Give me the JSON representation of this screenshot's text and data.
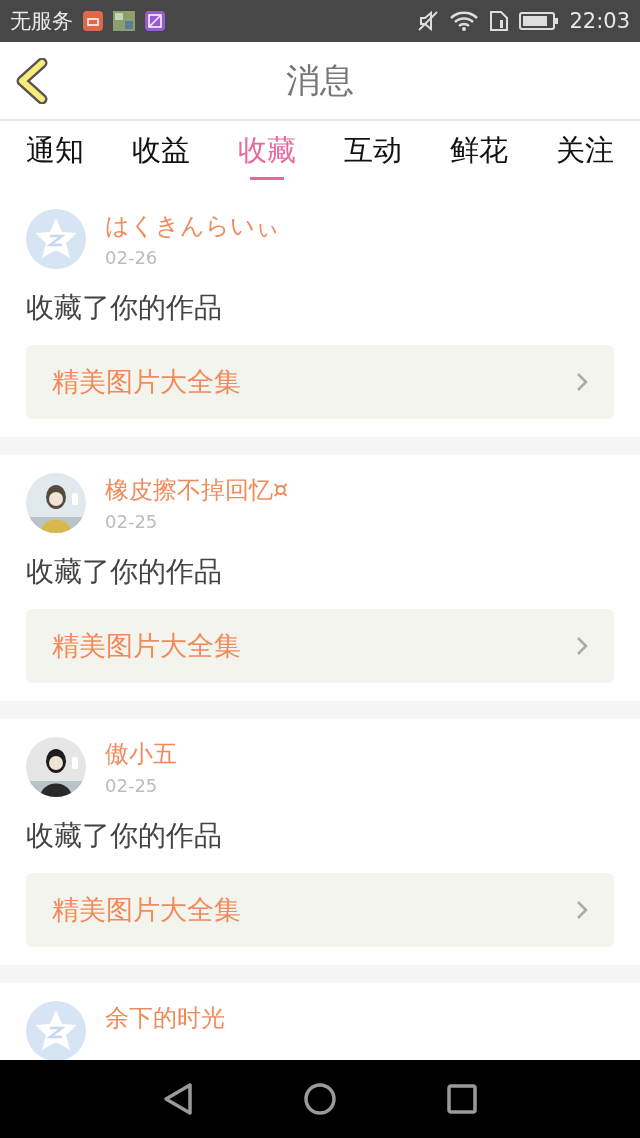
{
  "status_bar": {
    "carrier": "无服务",
    "time": "22:03"
  },
  "header": {
    "title": "消息"
  },
  "tabs": [
    {
      "label": "通知",
      "selected": false
    },
    {
      "label": "收益",
      "selected": false
    },
    {
      "label": "收藏",
      "selected": true
    },
    {
      "label": "互动",
      "selected": false
    },
    {
      "label": "鲜花",
      "selected": false
    },
    {
      "label": "关注",
      "selected": false
    }
  ],
  "messages": [
    {
      "avatar": {
        "kind": "default"
      },
      "name": "はくきんらいぃ",
      "date": "02-26",
      "text": "收藏了你的作品",
      "work": "精美图片大全集"
    },
    {
      "name": "橡皮擦不掉回忆¤",
      "date": "02-25",
      "text": "收藏了你的作品",
      "work": "精美图片大全集"
    },
    {
      "name": "傲小五",
      "date": "02-25",
      "text": "收藏了你的作品",
      "work": "精美图片大全集"
    },
    {
      "avatar": {
        "kind": "default"
      },
      "name": "余下的时光"
    }
  ]
}
